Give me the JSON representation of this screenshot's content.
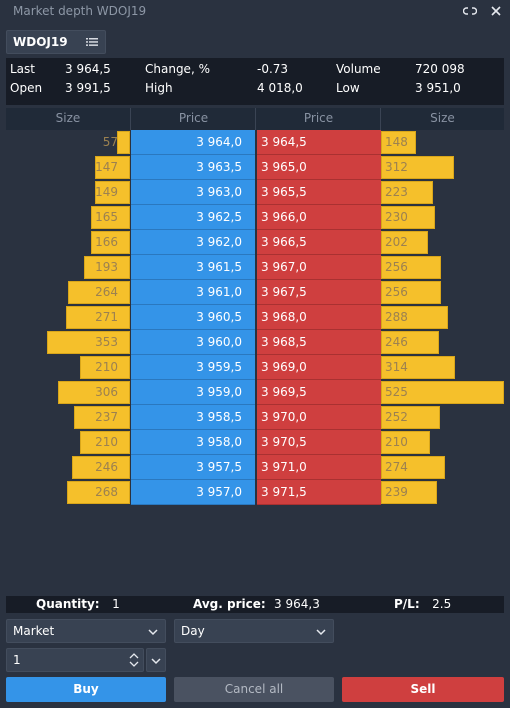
{
  "window": {
    "title": "Market depth WDOJ19",
    "link_icon": "link-icon",
    "close_icon": "close-icon"
  },
  "symbol": {
    "name": "WDOJ19",
    "list_icon": "list-icon"
  },
  "stats": {
    "last_label": "Last",
    "last_value": "3 964,5",
    "change_label": "Change, %",
    "change_value": "-0.73",
    "volume_label": "Volume",
    "volume_value": "720 098",
    "open_label": "Open",
    "open_value": "3 991,5",
    "high_label": "High",
    "high_value": "4 018,0",
    "low_label": "Low",
    "low_value": "3 951,0"
  },
  "book": {
    "headers": {
      "bid_size": "Size",
      "bid_price": "Price",
      "ask_price": "Price",
      "ask_size": "Size"
    },
    "max_size": 525,
    "rows": [
      {
        "bid_size": "57",
        "bid_price": "3 964,0",
        "ask_price": "3 964,5",
        "ask_size": "148"
      },
      {
        "bid_size": "147",
        "bid_price": "3 963,5",
        "ask_price": "3 965,0",
        "ask_size": "312"
      },
      {
        "bid_size": "149",
        "bid_price": "3 963,0",
        "ask_price": "3 965,5",
        "ask_size": "223"
      },
      {
        "bid_size": "165",
        "bid_price": "3 962,5",
        "ask_price": "3 966,0",
        "ask_size": "230"
      },
      {
        "bid_size": "166",
        "bid_price": "3 962,0",
        "ask_price": "3 966,5",
        "ask_size": "202"
      },
      {
        "bid_size": "193",
        "bid_price": "3 961,5",
        "ask_price": "3 967,0",
        "ask_size": "256"
      },
      {
        "bid_size": "264",
        "bid_price": "3 961,0",
        "ask_price": "3 967,5",
        "ask_size": "256"
      },
      {
        "bid_size": "271",
        "bid_price": "3 960,5",
        "ask_price": "3 968,0",
        "ask_size": "288"
      },
      {
        "bid_size": "353",
        "bid_price": "3 960,0",
        "ask_price": "3 968,5",
        "ask_size": "246"
      },
      {
        "bid_size": "210",
        "bid_price": "3 959,5",
        "ask_price": "3 969,0",
        "ask_size": "314"
      },
      {
        "bid_size": "306",
        "bid_price": "3 959,0",
        "ask_price": "3 969,5",
        "ask_size": "525"
      },
      {
        "bid_size": "237",
        "bid_price": "3 958,5",
        "ask_price": "3 970,0",
        "ask_size": "252"
      },
      {
        "bid_size": "210",
        "bid_price": "3 958,0",
        "ask_price": "3 970,5",
        "ask_size": "210"
      },
      {
        "bid_size": "246",
        "bid_price": "3 957,5",
        "ask_price": "3 971,0",
        "ask_size": "274"
      },
      {
        "bid_size": "268",
        "bid_price": "3 957,0",
        "ask_price": "3 971,5",
        "ask_size": "239"
      }
    ]
  },
  "summary": {
    "quantity_label": "Quantity:",
    "quantity_value": "1",
    "avg_price_label": "Avg. price:",
    "avg_price_value": "3 964,3",
    "pl_label": "P/L:",
    "pl_value": "2.5"
  },
  "order": {
    "type": "Market",
    "duration": "Day",
    "quantity": "1",
    "buy_label": "Buy",
    "cancel_all_label": "Cancel all",
    "sell_label": "Sell"
  },
  "colors": {
    "bid": "#3494e8",
    "ask": "#cf3f3f",
    "size_bar": "#f5c02b"
  }
}
